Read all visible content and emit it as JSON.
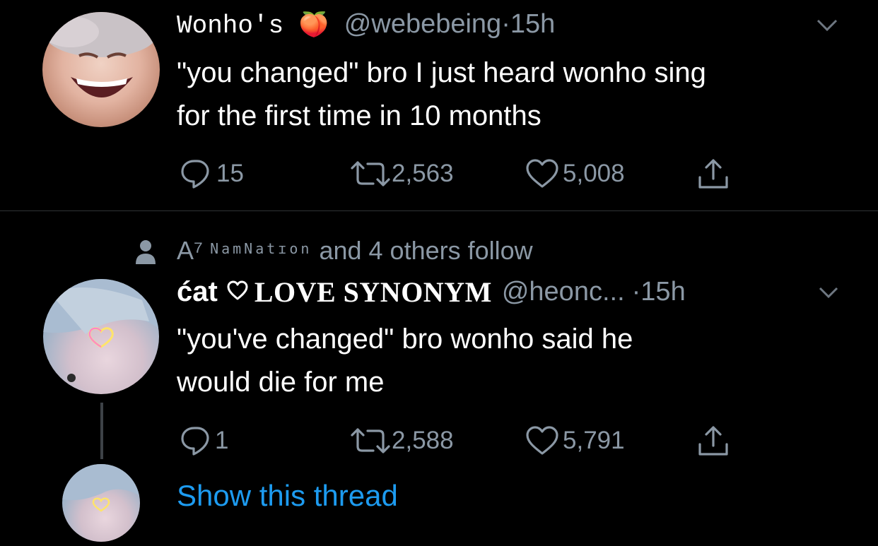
{
  "tweet1": {
    "display_name": "Wonho's",
    "emoji": "🍑",
    "handle": "@webebeing",
    "separator": "·",
    "time": "15h",
    "text_line1": "\"you changed\" bro I just heard wonho sing",
    "text_line2": "for the first time in 10 months",
    "replies": "15",
    "retweets": "2,563",
    "likes": "5,008"
  },
  "tweet2": {
    "social_context_prefix": "A⁷",
    "social_context_stylized": "NamNatɪon",
    "social_context_suffix": "and 4 others follow",
    "display_name_part1": "ćat",
    "display_name_part2": "LOVE SYNONYM",
    "handle": "@heonc...",
    "separator": "·",
    "time": "15h",
    "text_line1": "\"you've changed\" bro wonho said he",
    "text_line2": "would die for me",
    "replies": "1",
    "retweets": "2,588",
    "likes": "5,791"
  },
  "thread": {
    "show_thread_label": "Show this thread"
  },
  "colors": {
    "background": "#000000",
    "secondary_text": "#8b98a5",
    "link": "#1d9bf0",
    "divider": "#2f3336"
  }
}
